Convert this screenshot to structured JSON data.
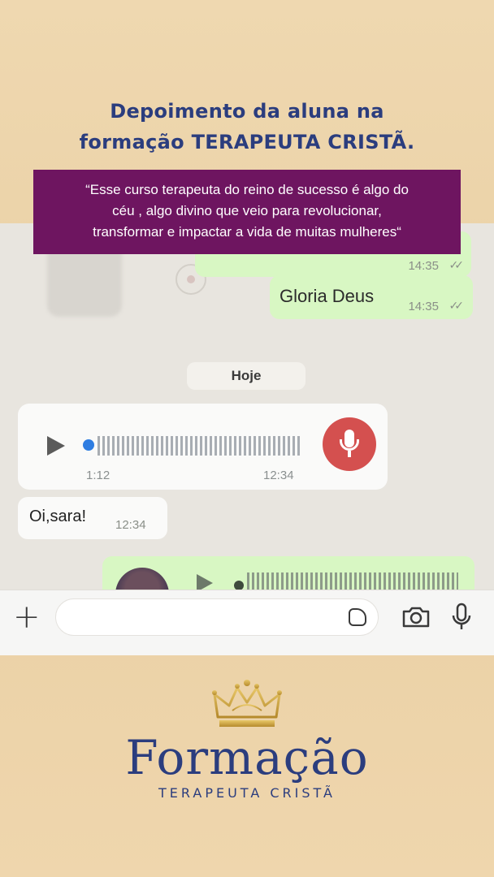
{
  "headline": {
    "line1": "Depoimento da aluna na",
    "line2": "formação TERAPEUTA CRISTÃ."
  },
  "quote": {
    "line1": "“Esse curso terapeuta do reino de sucesso é algo do",
    "line2": "céu , algo divino que veio para revolucionar,",
    "line3": "transformar e impactar a vida de muitas mulheres“"
  },
  "chat": {
    "top_bubble_time": "14:35",
    "gloria_message": "Gloria Deus",
    "gloria_time": "14:35",
    "day_label": "Hoje",
    "voice_message": {
      "duration": "1:12",
      "time": "12:34"
    },
    "incoming_message": "Oi,sara!",
    "incoming_time": "12:34"
  },
  "input_bar": {
    "placeholder": ""
  },
  "logo": {
    "brand": "Formação",
    "subtitle": "TERAPEUTA CRISTÃ"
  },
  "colors": {
    "headline": "#2b3d7e",
    "quote_bg": "#6e1560",
    "outgoing_bubble": "#d8f7c3",
    "mic_button": "#d4504f",
    "background": "#e9cfa3"
  },
  "icons": [
    "plus-icon",
    "sticker-icon",
    "camera-icon",
    "microphone-icon",
    "play-icon",
    "crown-icon"
  ]
}
